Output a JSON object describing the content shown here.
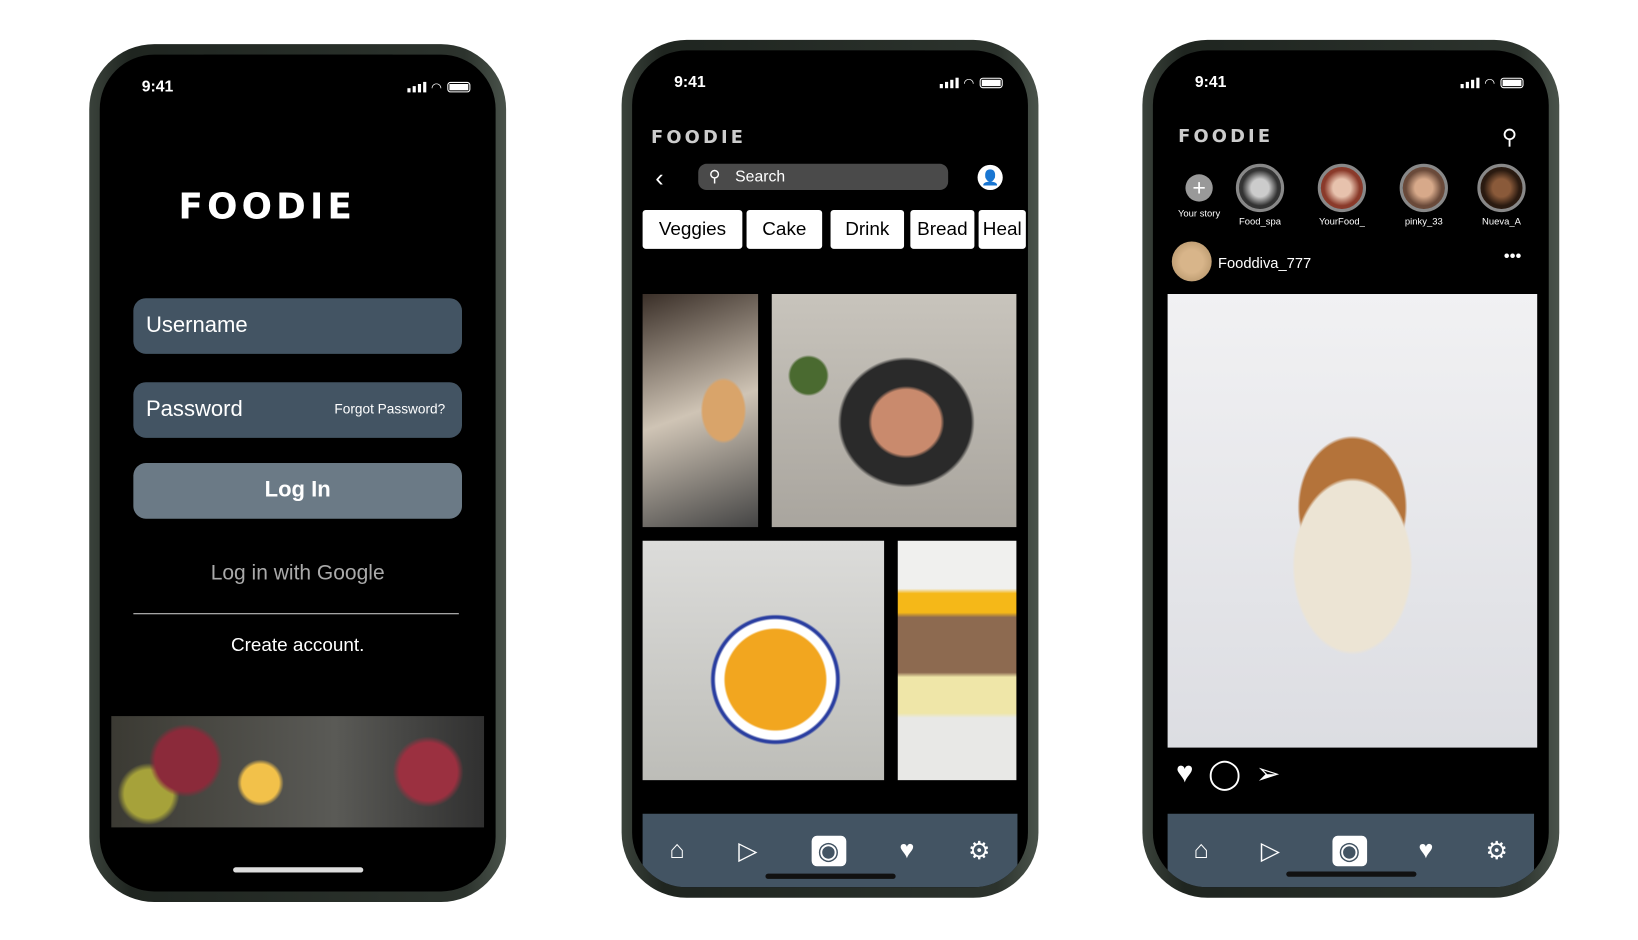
{
  "status": {
    "time": "9:41"
  },
  "login": {
    "logo": "FOODIE",
    "username_placeholder": "Username",
    "password_placeholder": "Password",
    "forgot": "Forgot Password?",
    "login": "Log In",
    "google": "Log in with Google",
    "create": "Create account."
  },
  "explore": {
    "logo": "FOODIE",
    "search_placeholder": "Search",
    "chips": [
      "Veggies",
      "Cake",
      "Drink",
      "Bread",
      "Heal"
    ]
  },
  "feed": {
    "logo": "FOODIE",
    "stories": [
      "Your story",
      "Food_spa",
      "YourFood_",
      "pinky_33",
      "Nueva_A"
    ],
    "post_user": "Fooddiva_777"
  },
  "nav_icons": [
    "home-icon",
    "play-icon",
    "camera-icon",
    "heart-icon",
    "gear-icon"
  ],
  "colors": {
    "field": "#435463",
    "button": "#6b7a86",
    "nav": "#435463"
  }
}
